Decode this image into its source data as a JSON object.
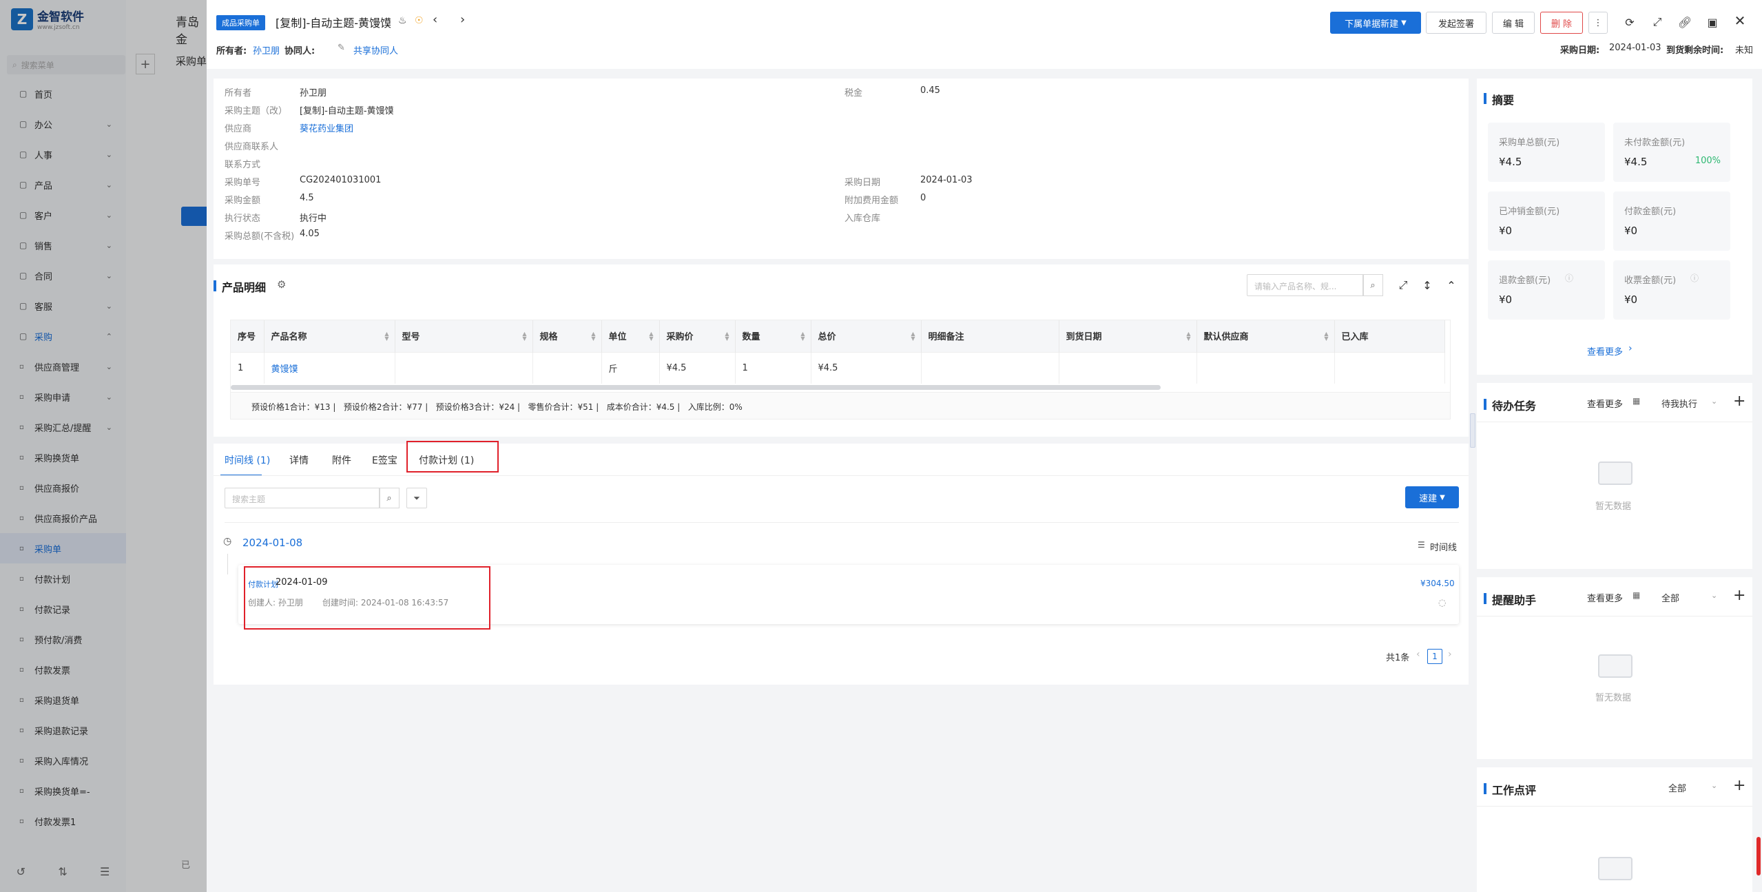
{
  "app": {
    "logo_title": "金智软件",
    "logo_sub": "www.jzsoft.cn",
    "search_placeholder": "搜索菜单"
  },
  "sidebar": {
    "items": [
      {
        "label": "首页",
        "icon": "home-icon"
      },
      {
        "label": "办公",
        "icon": "office-icon",
        "chev": "⌄"
      },
      {
        "label": "人事",
        "icon": "person-icon",
        "chev": "⌄"
      },
      {
        "label": "产品",
        "icon": "product-icon",
        "chev": "⌄"
      },
      {
        "label": "客户",
        "icon": "customer-icon",
        "chev": "⌄"
      },
      {
        "label": "销售",
        "icon": "sales-icon",
        "chev": "⌄"
      },
      {
        "label": "合同",
        "icon": "contract-icon",
        "chev": "⌄"
      },
      {
        "label": "客服",
        "icon": "service-icon",
        "chev": "⌄"
      },
      {
        "label": "采购",
        "icon": "purchase-icon",
        "chev": "⌃"
      }
    ],
    "sub_items": [
      {
        "label": "供应商管理",
        "chev": "⌄"
      },
      {
        "label": "采购申请",
        "chev": "⌄"
      },
      {
        "label": "采购汇总/提醒",
        "chev": "⌄"
      },
      {
        "label": "采购换货单"
      },
      {
        "label": "供应商报价"
      },
      {
        "label": "供应商报价产品"
      },
      {
        "label": "采购单"
      },
      {
        "label": "付款计划"
      },
      {
        "label": "付款记录"
      },
      {
        "label": "预付款/消费"
      },
      {
        "label": "付款发票"
      },
      {
        "label": "采购退货单"
      },
      {
        "label": "采购退款记录"
      },
      {
        "label": "采购入库情况"
      },
      {
        "label": "采购换货单=-"
      },
      {
        "label": "付款发票1"
      }
    ]
  },
  "behind": {
    "company": "青岛金",
    "page": "采购单",
    "footer": "已"
  },
  "header": {
    "type_tag": "成品采购单",
    "title": "[复制]-自动主题-黄馒馍",
    "owner_label": "所有者:",
    "owner": "孙卫朋",
    "collab_label": "协同人:",
    "share_label": "共享协同人",
    "new_sub_btn": "下属单据新建",
    "sign_btn": "发起签署",
    "edit_btn": "编 辑",
    "delete_btn": "删 除",
    "purchase_date_label": "采购日期:",
    "purchase_date": "2024-01-03",
    "remaining_label": "到货剩余时间:",
    "remaining": "未知"
  },
  "info": {
    "left": [
      {
        "label": "所有者",
        "value": "孙卫朋"
      },
      {
        "label": "采购主题（改）",
        "value": "[复制]-自动主题-黄馒馍"
      },
      {
        "label": "供应商",
        "value": "葵花药业集团"
      },
      {
        "label": "供应商联系人",
        "value": ""
      },
      {
        "label": "联系方式",
        "value": ""
      },
      {
        "label": "采购单号",
        "value": "CG202401031001"
      },
      {
        "label": "采购金额",
        "value": "4.5"
      },
      {
        "label": "执行状态",
        "value": "执行中"
      },
      {
        "label": "采购总额(不含税)",
        "value": "4.05"
      }
    ],
    "right": [
      {
        "label": "税金",
        "value": "0.45"
      },
      {
        "label": "采购日期",
        "value": "2024-01-03"
      },
      {
        "label": "附加费用金额",
        "value": "0"
      },
      {
        "label": "入库仓库",
        "value": ""
      }
    ]
  },
  "products": {
    "title": "产品明细",
    "search_placeholder": "请输入产品名称、规...",
    "columns": [
      "序号",
      "产品名称",
      "型号",
      "规格",
      "单位",
      "采购价",
      "数量",
      "总价",
      "明细备注",
      "到货日期",
      "默认供应商",
      "已入库"
    ],
    "rows": [
      [
        "1",
        "黄馒馍",
        "",
        "",
        "斤",
        "¥4.5",
        "1",
        "¥4.5",
        "",
        "",
        "",
        ""
      ]
    ],
    "summary": "预设价格1合计：¥13 |   预设价格2合计：¥77 |   预设价格3合计：¥24 |   零售价合计：¥51 |   成本价合计：¥4.5 |   入库比例：0%"
  },
  "tabs": [
    {
      "label": "时间线 (1)"
    },
    {
      "label": "详情"
    },
    {
      "label": "附件"
    },
    {
      "label": "E签宝"
    },
    {
      "label": "付款计划 (1)"
    }
  ],
  "timeline": {
    "search_placeholder": "搜索主题",
    "quick_btn": "速建",
    "date": "2024-01-08",
    "view_label": "时间线",
    "entry": {
      "tag": "付款计划",
      "date": "2024-01-09",
      "creator": "创建人: 孙卫朋",
      "created": "创建时间: 2024-01-08 16:43:57",
      "amount": "¥304.50"
    },
    "total": "共1条",
    "page": "1"
  },
  "summary": {
    "title": "摘要",
    "cards": [
      {
        "label": "采购单总额(元)",
        "value": "¥4.5"
      },
      {
        "label": "未付款金额(元)",
        "value": "¥4.5",
        "pct": "100%"
      },
      {
        "label": "已冲销金额(元)",
        "value": "¥0"
      },
      {
        "label": "付款金额(元)",
        "value": "¥0"
      },
      {
        "label": "退款金额(元)",
        "value": "¥0"
      },
      {
        "label": "收票金额(元)",
        "value": "¥0"
      }
    ],
    "more": "查看更多"
  },
  "todo": {
    "title": "待办任务",
    "more": "查看更多",
    "filter": "待我执行",
    "empty": "暂无数据"
  },
  "reminder": {
    "title": "提醒助手",
    "more": "查看更多",
    "filter": "全部",
    "empty": "暂无数据"
  },
  "review": {
    "title": "工作点评",
    "filter": "全部"
  },
  "colors": {
    "primary": "#1a6fd8",
    "danger": "#e04848",
    "highlight": "#e0202a",
    "success": "#2eb872"
  }
}
